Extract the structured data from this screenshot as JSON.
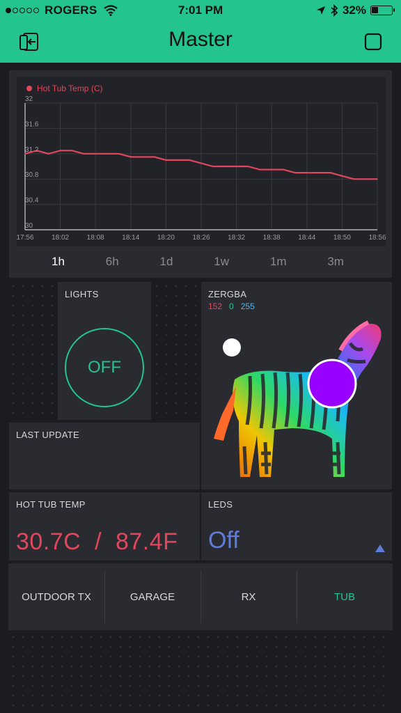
{
  "status_bar": {
    "carrier": "ROGERS",
    "signal_bars": 1,
    "time": "7:01 PM",
    "battery": "32%",
    "battery_level": 0.32,
    "icons": [
      "wifi-icon",
      "location-arrow-icon",
      "bluetooth-icon",
      "battery-icon"
    ]
  },
  "header": {
    "title": "Master",
    "left_icon": "exit-icon",
    "right_icon": "square-icon"
  },
  "chart": {
    "legend": "Hot Tub Temp (C)"
  },
  "chart_data": {
    "type": "line",
    "title": "",
    "series": [
      {
        "name": "Hot Tub Temp (C)",
        "color": "#e1465d",
        "x": [
          "17:56",
          "17:58",
          "18:00",
          "18:02",
          "18:04",
          "18:06",
          "18:08",
          "18:10",
          "18:12",
          "18:14",
          "18:16",
          "18:18",
          "18:20",
          "18:22",
          "18:24",
          "18:26",
          "18:28",
          "18:30",
          "18:32",
          "18:34",
          "18:36",
          "18:38",
          "18:40",
          "18:42",
          "18:44",
          "18:46",
          "18:48",
          "18:50",
          "18:52",
          "18:54",
          "18:56"
        ],
        "values": [
          31.2,
          31.25,
          31.2,
          31.25,
          31.25,
          31.2,
          31.2,
          31.2,
          31.2,
          31.15,
          31.15,
          31.15,
          31.1,
          31.1,
          31.1,
          31.05,
          31.0,
          31.0,
          31.0,
          31.0,
          30.95,
          30.95,
          30.95,
          30.9,
          30.9,
          30.9,
          30.9,
          30.85,
          30.8,
          30.8,
          30.8
        ]
      }
    ],
    "x_ticks": [
      "17:56",
      "18:02",
      "18:08",
      "18:14",
      "18:20",
      "18:26",
      "18:32",
      "18:38",
      "18:44",
      "18:50",
      "18:56"
    ],
    "y_ticks": [
      "30",
      "30.4",
      "30.8",
      "31.2",
      "31.6",
      "32"
    ],
    "ylim": [
      30,
      32
    ],
    "grid": true
  },
  "periods": [
    "1h",
    "6h",
    "1d",
    "1w",
    "1m",
    "3m"
  ],
  "active_period": "1h",
  "lights": {
    "label": "LIGHTS",
    "state": "OFF"
  },
  "zergba": {
    "label": "ZERGBA",
    "r": "152",
    "g": "0",
    "b": "255",
    "r_color": "#e1465d",
    "g_color": "#23c48e",
    "b_color": "#4fb5ee",
    "selected_color": "#9800ff"
  },
  "last_update": {
    "label": "LAST UPDATE"
  },
  "hot_tub": {
    "label": "HOT TUB TEMP",
    "value": "30.7C  /  87.4F"
  },
  "leds": {
    "label": "LEDS",
    "value": "Off"
  },
  "tabs": [
    {
      "label": "OUTDOOR TX",
      "active": false
    },
    {
      "label": "GARAGE",
      "active": false
    },
    {
      "label": "RX",
      "active": false
    },
    {
      "label": "TUB",
      "active": true
    }
  ]
}
